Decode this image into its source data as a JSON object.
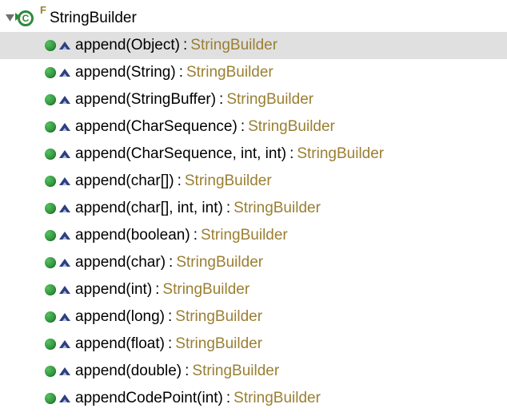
{
  "class": {
    "name": "StringBuilder",
    "modifier_badge": "F"
  },
  "methods": [
    {
      "name": "append",
      "params": "Object",
      "ret": "StringBuilder",
      "selected": true
    },
    {
      "name": "append",
      "params": "String",
      "ret": "StringBuilder",
      "selected": false
    },
    {
      "name": "append",
      "params": "StringBuffer",
      "ret": "StringBuilder",
      "selected": false
    },
    {
      "name": "append",
      "params": "CharSequence",
      "ret": "StringBuilder",
      "selected": false
    },
    {
      "name": "append",
      "params": "CharSequence, int, int",
      "ret": "StringBuilder",
      "selected": false
    },
    {
      "name": "append",
      "params": "char[]",
      "ret": "StringBuilder",
      "selected": false
    },
    {
      "name": "append",
      "params": "char[], int, int",
      "ret": "StringBuilder",
      "selected": false
    },
    {
      "name": "append",
      "params": "boolean",
      "ret": "StringBuilder",
      "selected": false
    },
    {
      "name": "append",
      "params": "char",
      "ret": "StringBuilder",
      "selected": false
    },
    {
      "name": "append",
      "params": "int",
      "ret": "StringBuilder",
      "selected": false
    },
    {
      "name": "append",
      "params": "long",
      "ret": "StringBuilder",
      "selected": false
    },
    {
      "name": "append",
      "params": "float",
      "ret": "StringBuilder",
      "selected": false
    },
    {
      "name": "append",
      "params": "double",
      "ret": "StringBuilder",
      "selected": false
    },
    {
      "name": "appendCodePoint",
      "params": "int",
      "ret": "StringBuilder",
      "selected": false
    }
  ],
  "colon": " :"
}
